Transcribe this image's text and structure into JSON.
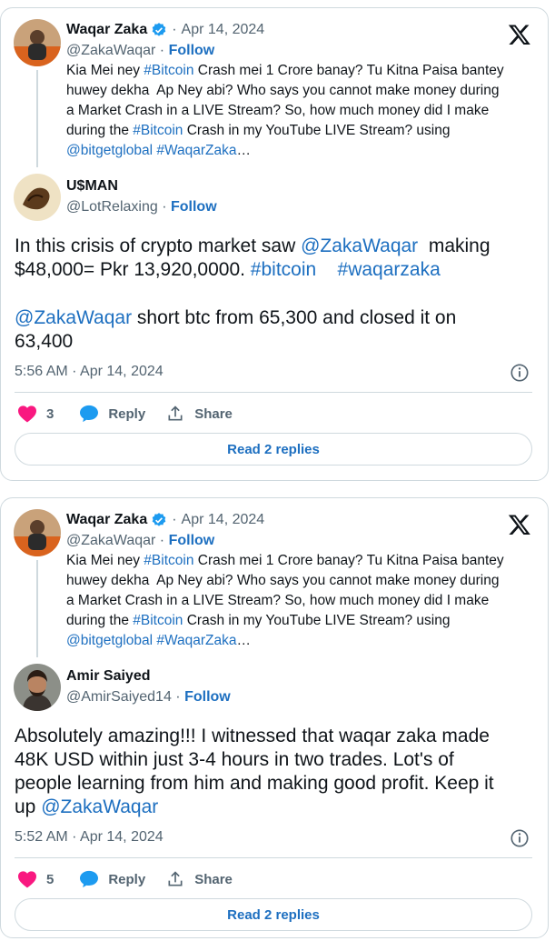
{
  "posts": [
    {
      "quoted": {
        "author": "Waqar Zaka",
        "handle": "@ZakaWaqar",
        "date": "Apr 14, 2024",
        "follow": "Follow",
        "lines": [
          [
            {
              "t": "Kia Mei ney "
            },
            {
              "t": "#Bitcoin",
              "link": true
            },
            {
              "t": " Crash mei 1 Crore banay? Tu Kitna Paisa bantey"
            }
          ],
          [
            {
              "t": "huwey dekha  Ap Ney abi? Who says you cannot make money during"
            }
          ],
          [
            {
              "t": "a Market Crash in a LIVE Stream? So, how much money did I make"
            }
          ],
          [
            {
              "t": "during the "
            },
            {
              "t": "#Bitcoin",
              "link": true
            },
            {
              "t": " Crash in my YouTube LIVE Stream? using"
            }
          ],
          [
            {
              "t": "@bitgetglobal #WaqarZaka",
              "link": true
            },
            {
              "t": "…"
            }
          ]
        ]
      },
      "reply": {
        "author": "U$MAN",
        "handle": "@LotRelaxing",
        "follow": "Follow",
        "paragraphs": [
          [
            [
              {
                "t": "In this crisis of crypto market saw "
              },
              {
                "t": "@ZakaWaqar",
                "link": true
              },
              {
                "t": "  making"
              }
            ],
            [
              {
                "t": "$48,000= Pkr 13,920,0000. "
              },
              {
                "t": "#bitcoin",
                "link": true
              },
              {
                "t": "    "
              },
              {
                "t": "#waqarzaka",
                "link": true
              }
            ]
          ],
          [
            [
              {
                "t": "@ZakaWaqar",
                "link": true
              },
              {
                "t": " short btc from 65,300 and closed it on"
              }
            ],
            [
              {
                "t": "63,400"
              }
            ]
          ]
        ],
        "timestamp": "5:56 AM · Apr 14, 2024",
        "likes": "3",
        "reply_label": "Reply",
        "share_label": "Share",
        "read_replies": "Read 2 replies"
      }
    },
    {
      "quoted": {
        "author": "Waqar Zaka",
        "handle": "@ZakaWaqar",
        "date": "Apr 14, 2024",
        "follow": "Follow",
        "lines": [
          [
            {
              "t": "Kia Mei ney "
            },
            {
              "t": "#Bitcoin",
              "link": true
            },
            {
              "t": " Crash mei 1 Crore banay? Tu Kitna Paisa bantey"
            }
          ],
          [
            {
              "t": "huwey dekha  Ap Ney abi? Who says you cannot make money during"
            }
          ],
          [
            {
              "t": "a Market Crash in a LIVE Stream? So, how much money did I make"
            }
          ],
          [
            {
              "t": "during the "
            },
            {
              "t": "#Bitcoin",
              "link": true
            },
            {
              "t": " Crash in my YouTube LIVE Stream? using"
            }
          ],
          [
            {
              "t": "@bitgetglobal #WaqarZaka",
              "link": true
            },
            {
              "t": "…"
            }
          ]
        ]
      },
      "reply": {
        "author": "Amir Saiyed",
        "handle": "@AmirSaiyed14",
        "follow": "Follow",
        "paragraphs": [
          [
            [
              {
                "t": "Absolutely amazing!!! I witnessed that waqar zaka made"
              }
            ],
            [
              {
                "t": "48K USD within just 3-4 hours in two trades. Lot's of"
              }
            ],
            [
              {
                "t": "people learning from him and making good profit. Keep it"
              }
            ],
            [
              {
                "t": "up "
              },
              {
                "t": "@ZakaWaqar",
                "link": true
              }
            ]
          ]
        ],
        "timestamp": "5:52 AM · Apr 14, 2024",
        "likes": "5",
        "reply_label": "Reply",
        "share_label": "Share",
        "read_replies": "Read 2 replies"
      }
    }
  ],
  "colors": {
    "link": "#1d6fc0",
    "heart": "#f91880",
    "muted": "#536471",
    "border": "#cfd9de",
    "verified": "#1d9bf0"
  },
  "icons": [
    "x-logo-icon",
    "verified-badge-icon",
    "heart-icon",
    "reply-bubble-icon",
    "share-icon",
    "info-icon"
  ]
}
